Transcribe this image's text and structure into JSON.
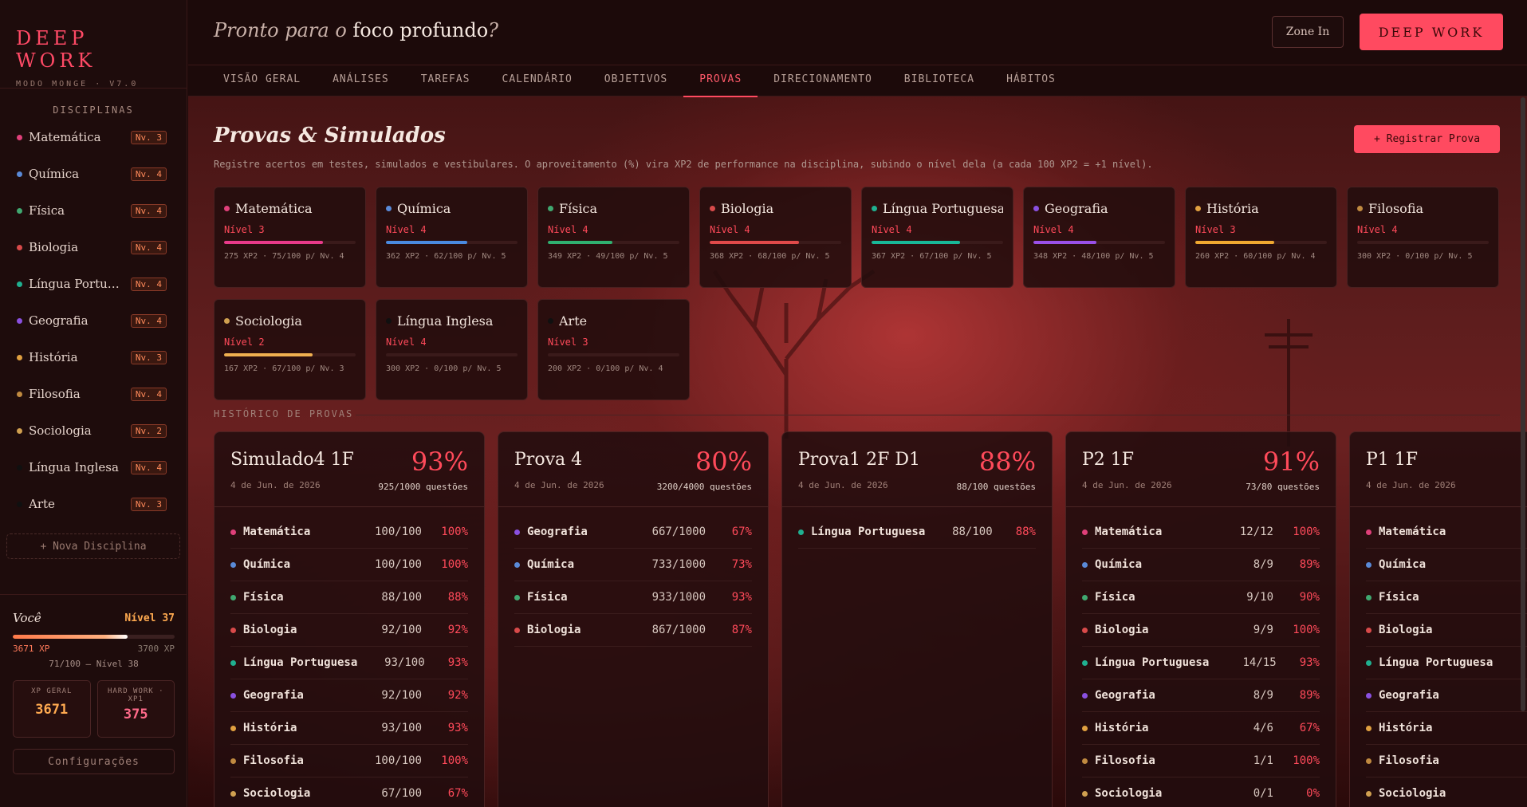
{
  "brand": {
    "title": "DEEP WORK",
    "subtitle": "MODO MONGE · V7.0"
  },
  "sidebar": {
    "disciplines_heading": "DISCIPLINAS",
    "disciplines": [
      {
        "name": "Matemática",
        "level": "Nv. 3",
        "color": "#e0407a"
      },
      {
        "name": "Química",
        "level": "Nv. 4",
        "color": "#5a8ad8"
      },
      {
        "name": "Física",
        "level": "Nv. 4",
        "color": "#40a870"
      },
      {
        "name": "Biologia",
        "level": "Nv. 4",
        "color": "#d84a4a"
      },
      {
        "name": "Língua Portug...",
        "level": "Nv. 4",
        "color": "#20b090"
      },
      {
        "name": "Geografia",
        "level": "Nv. 4",
        "color": "#8a50e0"
      },
      {
        "name": "História",
        "level": "Nv. 3",
        "color": "#e0a040"
      },
      {
        "name": "Filosofia",
        "level": "Nv. 4",
        "color": "#c08a40"
      },
      {
        "name": "Sociologia",
        "level": "Nv. 2",
        "color": "#d0a050"
      },
      {
        "name": "Língua Inglesa",
        "level": "Nv. 4",
        "color": "#101010"
      },
      {
        "name": "Arte",
        "level": "Nv. 3",
        "color": "#101010"
      }
    ],
    "new_discipline": "+ Nova Disciplina",
    "you": {
      "label": "Você",
      "level": "Nível 37",
      "xp_current": "3671 XP",
      "xp_max": "3700 XP",
      "progress": 0.71,
      "next": "71/100 — Nível 38",
      "xp_geral_label": "XP GERAL",
      "xp_geral": "3671",
      "hard_work_label": "HARD WORK · XP1",
      "hard_work": "375"
    },
    "config": "Configurações"
  },
  "header": {
    "greeting_prefix": "Pronto para o",
    "greeting_bold": "foco profundo",
    "greeting_suffix": "?",
    "zone_in": "Zone In",
    "deep_work": "DEEP WORK"
  },
  "tabs": [
    "VISÃO GERAL",
    "ANÁLISES",
    "TAREFAS",
    "CALENDÁRIO",
    "OBJETIVOS",
    "PROVAS",
    "DIRECIONAMENTO",
    "BIBLIOTECA",
    "HÁBITOS"
  ],
  "active_tab": "PROVAS",
  "page": {
    "title": "Provas & Simulados",
    "subtitle": "Registre acertos em testes, simulados e vestibulares. O aproveitamento (%) vira XP2 de performance na disciplina, subindo o nível dela (a cada 100 XP2 = +1 nível).",
    "register_button": "+ Registrar Prova",
    "history_heading": "HISTÓRICO DE PROVAS"
  },
  "subjects": [
    {
      "name": "Matemática",
      "color": "#e0407a",
      "level": "Nível 3",
      "progress": 0.75,
      "bar_color": "#e83a8a",
      "info": "275 XP2 · 75/100 p/ Nv. 4"
    },
    {
      "name": "Química",
      "color": "#5a8ad8",
      "level": "Nível 4",
      "progress": 0.62,
      "bar_color": "#4a8ae0",
      "info": "362 XP2 · 62/100 p/ Nv. 5"
    },
    {
      "name": "Física",
      "color": "#40a870",
      "level": "Nível 4",
      "progress": 0.49,
      "bar_color": "#30b070",
      "info": "349 XP2 · 49/100 p/ Nv. 5"
    },
    {
      "name": "Biologia",
      "color": "#d84a4a",
      "level": "Nível 4",
      "progress": 0.68,
      "bar_color": "#e04a4a",
      "info": "368 XP2 · 68/100 p/ Nv. 5"
    },
    {
      "name": "Língua Portuguesa",
      "color": "#20b090",
      "level": "Nível 4",
      "progress": 0.67,
      "bar_color": "#18b898",
      "info": "367 XP2 · 67/100 p/ Nv. 5"
    },
    {
      "name": "Geografia",
      "color": "#8a50e0",
      "level": "Nível 4",
      "progress": 0.48,
      "bar_color": "#9a50e8",
      "info": "348 XP2 · 48/100 p/ Nv. 5"
    },
    {
      "name": "História",
      "color": "#e0a040",
      "level": "Nível 3",
      "progress": 0.6,
      "bar_color": "#f0a830",
      "info": "260 XP2 · 60/100 p/ Nv. 4"
    },
    {
      "name": "Filosofia",
      "color": "#c08a40",
      "level": "Nível 4",
      "progress": 0.0,
      "bar_color": "#c08a40",
      "info": "300 XP2 · 0/100 p/ Nv. 5"
    },
    {
      "name": "Sociologia",
      "color": "#d0a050",
      "level": "Nível 2",
      "progress": 0.67,
      "bar_color": "#f0b050",
      "info": "167 XP2 · 67/100 p/ Nv. 3"
    },
    {
      "name": "Língua Inglesa",
      "color": "#101010",
      "level": "Nível 4",
      "progress": 0.0,
      "bar_color": "#444444",
      "info": "300 XP2 · 0/100 p/ Nv. 5"
    },
    {
      "name": "Arte",
      "color": "#101010",
      "level": "Nível 3",
      "progress": 0.0,
      "bar_color": "#444444",
      "info": "200 XP2 · 0/100 p/ Nv. 4"
    }
  ],
  "exams": [
    {
      "title": "Simulado4 1F",
      "date": "4 de Jun. de 2026",
      "percent": "93%",
      "questions": "925/1000 questões",
      "items": [
        {
          "name": "Matemática",
          "color": "#e0407a",
          "score": "100/100",
          "pct": "100%"
        },
        {
          "name": "Química",
          "color": "#5a8ad8",
          "score": "100/100",
          "pct": "100%"
        },
        {
          "name": "Física",
          "color": "#40a870",
          "score": "88/100",
          "pct": "88%"
        },
        {
          "name": "Biologia",
          "color": "#d84a4a",
          "score": "92/100",
          "pct": "92%"
        },
        {
          "name": "Língua Portuguesa",
          "color": "#20b090",
          "score": "93/100",
          "pct": "93%"
        },
        {
          "name": "Geografia",
          "color": "#8a50e0",
          "score": "92/100",
          "pct": "92%"
        },
        {
          "name": "História",
          "color": "#e0a040",
          "score": "93/100",
          "pct": "93%"
        },
        {
          "name": "Filosofia",
          "color": "#c08a40",
          "score": "100/100",
          "pct": "100%"
        },
        {
          "name": "Sociologia",
          "color": "#d0a050",
          "score": "67/100",
          "pct": "67%"
        }
      ]
    },
    {
      "title": "Prova 4",
      "date": "4 de Jun. de 2026",
      "percent": "80%",
      "questions": "3200/4000 questões",
      "items": [
        {
          "name": "Geografia",
          "color": "#8a50e0",
          "score": "667/1000",
          "pct": "67%"
        },
        {
          "name": "Química",
          "color": "#5a8ad8",
          "score": "733/1000",
          "pct": "73%"
        },
        {
          "name": "Física",
          "color": "#40a870",
          "score": "933/1000",
          "pct": "93%"
        },
        {
          "name": "Biologia",
          "color": "#d84a4a",
          "score": "867/1000",
          "pct": "87%"
        }
      ]
    },
    {
      "title": "Prova1 2F D1",
      "date": "4 de Jun. de 2026",
      "percent": "88%",
      "questions": "88/100 questões",
      "items": [
        {
          "name": "Língua Portuguesa",
          "color": "#20b090",
          "score": "88/100",
          "pct": "88%"
        }
      ]
    },
    {
      "title": "P2 1F",
      "date": "4 de Jun. de 2026",
      "percent": "91%",
      "questions": "73/80 questões",
      "items": [
        {
          "name": "Matemática",
          "color": "#e0407a",
          "score": "12/12",
          "pct": "100%"
        },
        {
          "name": "Química",
          "color": "#5a8ad8",
          "score": "8/9",
          "pct": "89%"
        },
        {
          "name": "Física",
          "color": "#40a870",
          "score": "9/10",
          "pct": "90%"
        },
        {
          "name": "Biologia",
          "color": "#d84a4a",
          "score": "9/9",
          "pct": "100%"
        },
        {
          "name": "Língua Portuguesa",
          "color": "#20b090",
          "score": "14/15",
          "pct": "93%"
        },
        {
          "name": "Geografia",
          "color": "#8a50e0",
          "score": "8/9",
          "pct": "89%"
        },
        {
          "name": "História",
          "color": "#e0a040",
          "score": "4/6",
          "pct": "67%"
        },
        {
          "name": "Filosofia",
          "color": "#c08a40",
          "score": "1/1",
          "pct": "100%"
        },
        {
          "name": "Sociologia",
          "color": "#d0a050",
          "score": "0/1",
          "pct": "0%"
        }
      ]
    },
    {
      "title": "P1 1F",
      "date": "4 de Jun. de 2026",
      "percent": "",
      "questions": "",
      "items": [
        {
          "name": "Matemática",
          "color": "#e0407a",
          "score": "",
          "pct": ""
        },
        {
          "name": "Química",
          "color": "#5a8ad8",
          "score": "",
          "pct": ""
        },
        {
          "name": "Física",
          "color": "#40a870",
          "score": "",
          "pct": ""
        },
        {
          "name": "Biologia",
          "color": "#d84a4a",
          "score": "",
          "pct": ""
        },
        {
          "name": "Língua Portuguesa",
          "color": "#20b090",
          "score": "",
          "pct": ""
        },
        {
          "name": "Geografia",
          "color": "#8a50e0",
          "score": "",
          "pct": ""
        },
        {
          "name": "História",
          "color": "#e0a040",
          "score": "",
          "pct": ""
        },
        {
          "name": "Filosofia",
          "color": "#c08a40",
          "score": "",
          "pct": ""
        },
        {
          "name": "Sociologia",
          "color": "#d0a050",
          "score": "",
          "pct": ""
        }
      ]
    }
  ],
  "colors": {
    "accent": "#ff4a60",
    "xp_bar_start": "#ff7a4a",
    "xp_bar_end": "#ffffff",
    "xp_geral": "#ffaa50",
    "hard_work": "#ff6a8a"
  }
}
